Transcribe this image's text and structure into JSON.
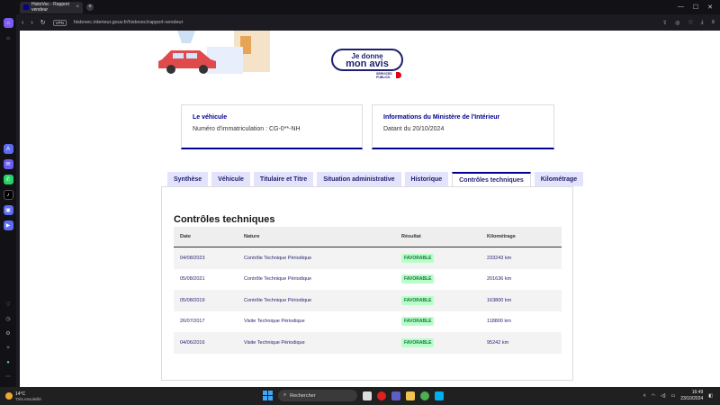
{
  "browser": {
    "tab_title": "HistoVec - Rapport vendeur",
    "tab_close": "×",
    "new_tab": "+",
    "url": "histovec.interieur.gouv.fr/histovec/rapport-vendeur",
    "vpn_label": "VPN",
    "window_controls": [
      "—",
      "☐",
      "✕"
    ]
  },
  "hero": {
    "button_line1": "Je donne",
    "button_line2": "mon avis",
    "logo_text_1": "SERVICES",
    "logo_text_2": "PUBLICS"
  },
  "cards": {
    "vehicle": {
      "title": "Le véhicule",
      "value": "Numéro d'immatriculation : CG-0**-NH"
    },
    "ministry": {
      "title": "Informations du Ministère de l'Intérieur",
      "value": "Datant du 20/10/2024"
    }
  },
  "tabs": [
    {
      "label": "Synthèse"
    },
    {
      "label": "Véhicule"
    },
    {
      "label": "Titulaire et Titre"
    },
    {
      "label": "Situation administrative"
    },
    {
      "label": "Historique"
    },
    {
      "label": "Contrôles techniques"
    },
    {
      "label": "Kilométrage"
    }
  ],
  "active_tab": "Contrôles techniques",
  "section": {
    "title": "Contrôles techniques",
    "columns": [
      "Date",
      "Nature",
      "Résultat",
      "Kilométrage"
    ],
    "rows": [
      {
        "date": "04/08/2023",
        "nature": "Contrôle Technique Périodique",
        "result": "FAVORABLE",
        "km": "233243 km"
      },
      {
        "date": "05/08/2021",
        "nature": "Contrôle Technique Périodique",
        "result": "FAVORABLE",
        "km": "201636 km"
      },
      {
        "date": "05/08/2019",
        "nature": "Contrôle Technique Périodique",
        "result": "FAVORABLE",
        "km": "163800 km"
      },
      {
        "date": "26/07/2017",
        "nature": "Visite Technique Périodique",
        "result": "FAVORABLE",
        "km": "118800 km"
      },
      {
        "date": "04/06/2016",
        "nature": "Visite Technique Périodique",
        "result": "FAVORABLE",
        "km": "95242 km"
      }
    ]
  },
  "taskbar": {
    "temperature": "14°C",
    "weather": "Très ensoleillé",
    "search_placeholder": "Rechercher",
    "time": "16:49",
    "date": "23/10/2024"
  },
  "colors": {
    "primary": "#000091",
    "badge_bg": "#b8fec9",
    "badge_text": "#18753c"
  }
}
